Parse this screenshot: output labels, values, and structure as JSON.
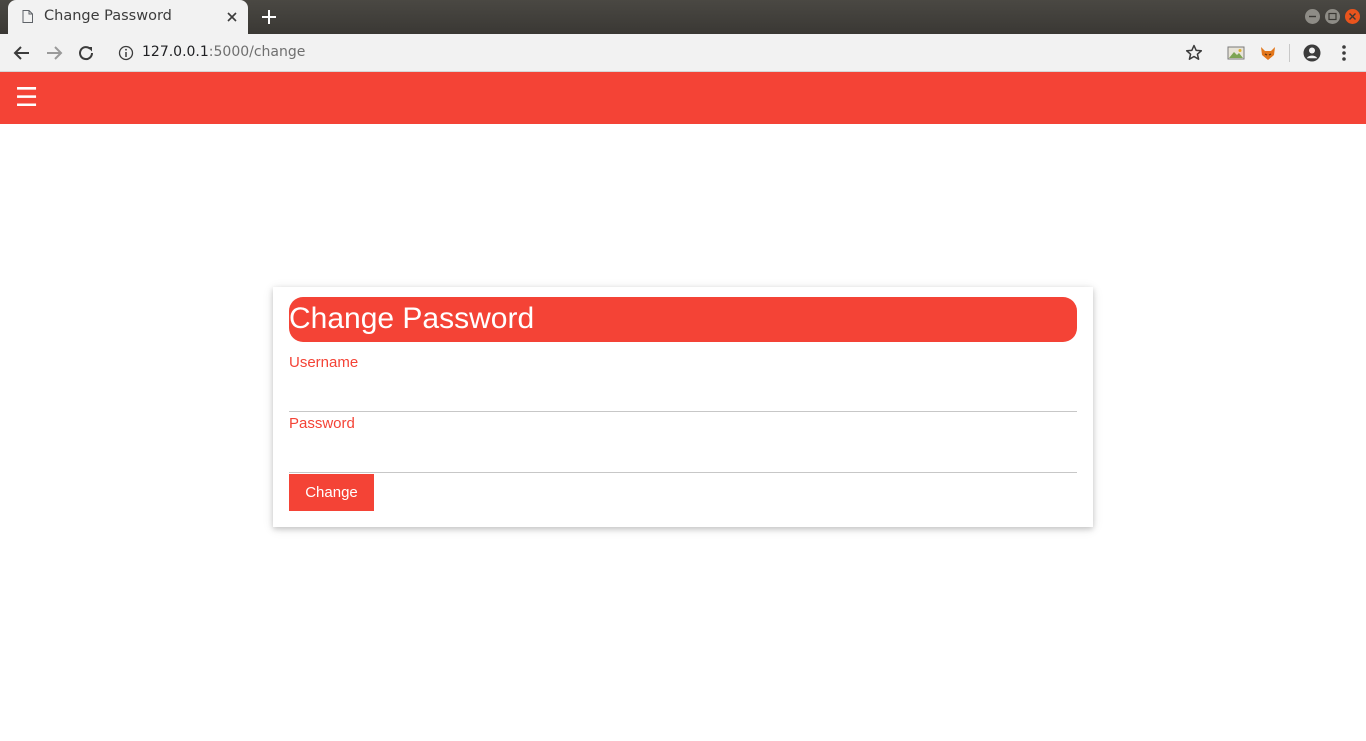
{
  "browser": {
    "tab_title": "Change Password",
    "url_host": "127.0.0.1",
    "url_path": ":5000/change",
    "icons": [
      "page-icon",
      "close-icon",
      "new-tab-icon",
      "back-icon",
      "forward-icon",
      "reload-icon",
      "info-icon",
      "star-icon",
      "image-extension-icon",
      "fox-extension-icon",
      "account-icon",
      "menu-dots-icon",
      "minimize-icon",
      "maximize-icon",
      "window-close-icon"
    ]
  },
  "appbar": {
    "menu_glyph": "☰",
    "color": "#f44336"
  },
  "form": {
    "title": "Change Password",
    "username_label": "Username",
    "username_value": "",
    "password_label": "Password",
    "password_value": "",
    "submit_label": "Change"
  },
  "colors": {
    "accent": "#f44336",
    "tab_strip": "#403e3a",
    "toolbar": "#f2f2f2"
  }
}
